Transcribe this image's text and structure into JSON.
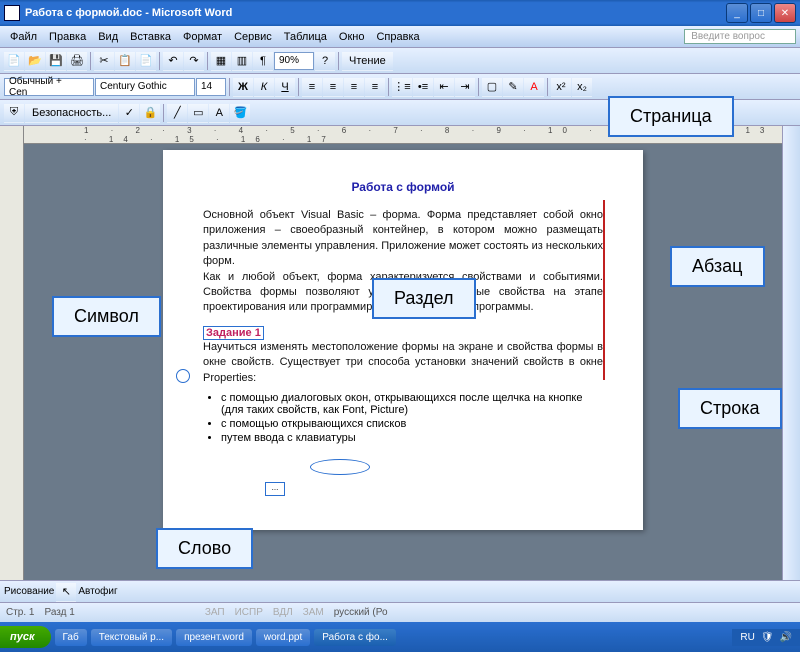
{
  "titlebar": {
    "title": "Работа с формой.doc - Microsoft Word"
  },
  "menu": {
    "file": "Файл",
    "edit": "Правка",
    "view": "Вид",
    "insert": "Вставка",
    "format": "Формат",
    "service": "Сервис",
    "table": "Таблица",
    "window": "Окно",
    "help": "Справка",
    "question": "Введите вопрос"
  },
  "toolbar2": {
    "style": "Обычный + Cen",
    "font": "Century Gothic",
    "size": "14"
  },
  "toolbar1": {
    "zoom": "90%",
    "read": "Чтение"
  },
  "toolbar3": {
    "security": "Безопасность..."
  },
  "ruler": "1 · 2 · 3 · 4 · 5 · 6 · 7 · 8 · 9 · 10 · 11 · 12 · 13 · 14 · 15 · 16 · 17",
  "doc": {
    "title": "Работа с формой",
    "para1": "Основной объект Visual Basic – форма. Форма представляет собой окно приложения – своеобразный контейнер, в котором можно размещать различные элементы управления. Приложение может состоять из нескольких форм.",
    "para2": "Как и любой объект, форма характеризуется свойствами и событиями. Свойства формы позволяют установить начальные свойства на этапе проектирования или программирования в окне кода программы.",
    "task": "Задание 1",
    "para3": "Научиться изменять местоположение формы на экране и свойства формы в окне свойств. Существует три способа установки значений свойств в окне Properties:",
    "b1": "с помощью диалоговых окон, открывающихся после щелчка на кнопке           (для таких свойств, как Font, Picture)",
    "b2": "с помощью открывающихся списков",
    "b3": "путем ввода с клавиатуры",
    "dots": "..."
  },
  "draw": {
    "drawing": "Рисование",
    "autoshapes": "Автофиг"
  },
  "status": {
    "page": "Стр. 1",
    "section": "Разд 1",
    "rec": "ЗАП",
    "fix": "ИСПР",
    "ext": "ВДЛ",
    "ovr": "ЗАМ",
    "lang": "русский (Ро"
  },
  "taskbar": {
    "start": "пуск",
    "t1": "Габ",
    "t2": "Текстовый р...",
    "t3": "презент.word",
    "t4": "word.ppt",
    "t5": "Работа с фо...",
    "lang": "RU"
  },
  "callouts": {
    "page": "Страница",
    "section": "Раздел",
    "symbol": "Символ",
    "paragraph": "Абзац",
    "line": "Строка",
    "word": "Слово"
  }
}
